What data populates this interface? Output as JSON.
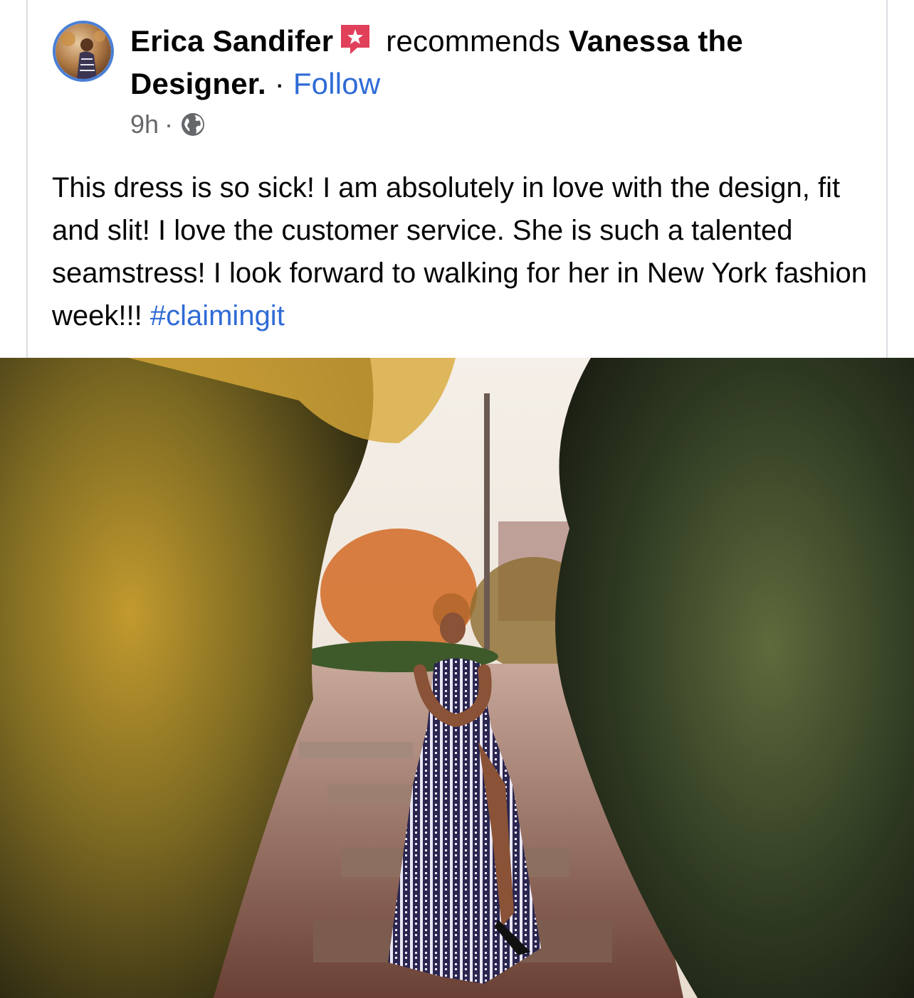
{
  "post": {
    "author": "Erica Sandifer",
    "recommends_text": "recommends",
    "page_name_part1": "Vanessa the",
    "page_name_part2": "Designer.",
    "separator": "·",
    "follow_label": "Follow",
    "timestamp": "9h",
    "meta_separator": "·",
    "privacy_icon": "globe-icon",
    "recommend_icon": "recommend-star-icon",
    "body_text": "This dress is so sick! I am absolutely in love with the design, fit and slit! I love the customer service. She is such a talented seamstress! I look forward to walking for her in New York fashion week!!!",
    "hashtag": "#claimingit"
  },
  "colors": {
    "link_blue": "#2f6bd6",
    "recommend_red": "#e0405a",
    "meta_gray": "#65676b",
    "avatar_ring": "#4a7fd6"
  }
}
